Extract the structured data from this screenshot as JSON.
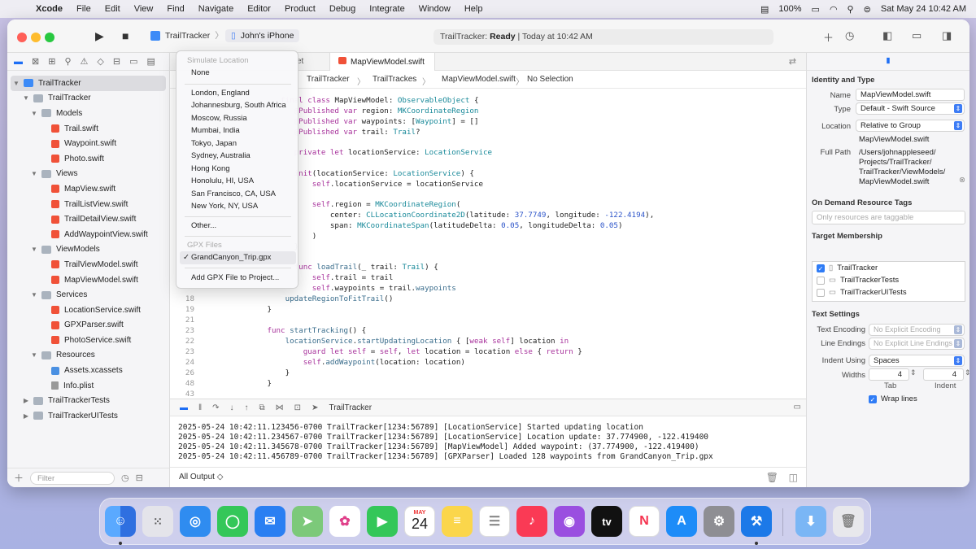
{
  "menubar": {
    "app": "Xcode",
    "items": [
      "File",
      "Edit",
      "View",
      "Find",
      "Navigate",
      "Editor",
      "Product",
      "Debug",
      "Integrate",
      "Window",
      "Help"
    ],
    "battery": "100%",
    "datetime": "Sat May 24  10:42 AM"
  },
  "toolbar": {
    "scheme": "TrailTracker",
    "device": "John's iPhone",
    "status_app": "TrailTracker:",
    "status_state": "Ready",
    "status_time": "| Today at 10:42 AM"
  },
  "navigator": {
    "filter_placeholder": "Filter",
    "items": [
      {
        "label": "TrailTracker",
        "type": "project"
      },
      {
        "label": "TrailTracker",
        "type": "folder"
      },
      {
        "label": "Models",
        "type": "folder"
      },
      {
        "label": "Trail.swift",
        "type": "swift"
      },
      {
        "label": "Waypoint.swift",
        "type": "swift"
      },
      {
        "label": "Photo.swift",
        "type": "swift"
      },
      {
        "label": "Views",
        "type": "folder"
      },
      {
        "label": "MapView.swift",
        "type": "swift"
      },
      {
        "label": "TrailListView.swift",
        "type": "swift"
      },
      {
        "label": "TrailDetailView.swift",
        "type": "swift"
      },
      {
        "label": "AddWaypointView.swift",
        "type": "swift"
      },
      {
        "label": "ViewModels",
        "type": "folder"
      },
      {
        "label": "TrailViewModel.swift",
        "type": "swift"
      },
      {
        "label": "MapViewModel.swift",
        "type": "swift"
      },
      {
        "label": "Services",
        "type": "folder"
      },
      {
        "label": "LocationService.swift",
        "type": "swift"
      },
      {
        "label": "GPXParser.swift",
        "type": "swift"
      },
      {
        "label": "PhotoService.swift",
        "type": "swift"
      },
      {
        "label": "Resources",
        "type": "folder"
      },
      {
        "label": "Assets.xcassets",
        "type": "asset"
      },
      {
        "label": "Info.plist",
        "type": "plist"
      },
      {
        "label": "TrailTrackerTests",
        "type": "folder"
      },
      {
        "label": "TrailTrackerUITests",
        "type": "folder"
      }
    ]
  },
  "editor": {
    "tab_partial": "et",
    "tab_active": "MapViewModel.swift",
    "jump": [
      "TrailTracker",
      "TrailTrackes",
      "MapViewModel.swift",
      "No Selection"
    ]
  },
  "simulate_menu": {
    "header": "Simulate Location",
    "none": "None",
    "locations": [
      "London, England",
      "Johannesburg, South Africa",
      "Moscow, Russia",
      "Mumbai, India",
      "Tokyo, Japan",
      "Sydney, Australia",
      "Hong Kong",
      "Honolulu, HI, USA",
      "San Francisco, CA, USA",
      "New York, NY, USA"
    ],
    "other": "Other...",
    "gpx_header": "GPX Files",
    "gpx_file": "GrandCanyon_Trip.gpx",
    "add_gpx": "Add GPX File to Project..."
  },
  "debug": {
    "target": "TrailTracker",
    "logs": [
      "2025-05-24 10:42:11.123456-0700 TrailTracker[1234:56789] [LocationService] Started updating location",
      "2025-05-24 10:42:11.234567-0700 TrailTracker[1234:56789] [LocationService] Location update: 37.774900, -122.419400",
      "2025-05-24 10:42:11.345678-0700 TrailTracker[1234:56789] [MapViewModel] Added waypoint: (37.774900, -122.419400)",
      "2025-05-24 10:42:11.456789-0700 TrailTracker[1234:56789] [GPXParser] Loaded 128 waypoints from GrandCanyon_Trip.gpx"
    ],
    "output_selector": "All Output ◇"
  },
  "inspector": {
    "identity_type_title": "Identity and Type",
    "name_label": "Name",
    "name_value": "MapViewModel.swift",
    "type_label": "Type",
    "type_value": "Default - Swift Source",
    "location_label": "Location",
    "location_value": "Relative to Group",
    "location_file": "MapViewModel.swift",
    "fullpath_label": "Full Path",
    "fullpath_lines": [
      "/Users/johnappleseed/",
      "Projects/TrailTracker/",
      "TrailTracker/ViewModels/",
      "MapViewModel.swift"
    ],
    "odr_title": "On Demand Resource Tags",
    "odr_placeholder": "Only resources are taggable",
    "target_title": "Target Membership",
    "targets": [
      {
        "name": "TrailTracker",
        "checked": true
      },
      {
        "name": "TrailTrackerTests",
        "checked": false
      },
      {
        "name": "TrailTrackerUITests",
        "checked": false
      }
    ],
    "text_settings_title": "Text Settings",
    "encoding_label": "Text Encoding",
    "encoding_value": "No Explicit Encoding",
    "endings_label": "Line Endings",
    "endings_value": "No Explicit Line Endings",
    "indent_label": "Indent Using",
    "indent_value": "Spaces",
    "widths_label": "Widths",
    "tab_width": "4",
    "indent_width": "4",
    "tab_label": "Tab",
    "indent_sub_label": "Indent",
    "wrap_label": "Wrap lines"
  },
  "dock": {
    "calendar_month": "MAY",
    "calendar_day": "24",
    "tv_label": "tv"
  },
  "colors": {
    "accent": "#1d6ef5",
    "keyword": "#a8339c",
    "type": "#1a8a9a",
    "swift_icon": "#f05138"
  }
}
